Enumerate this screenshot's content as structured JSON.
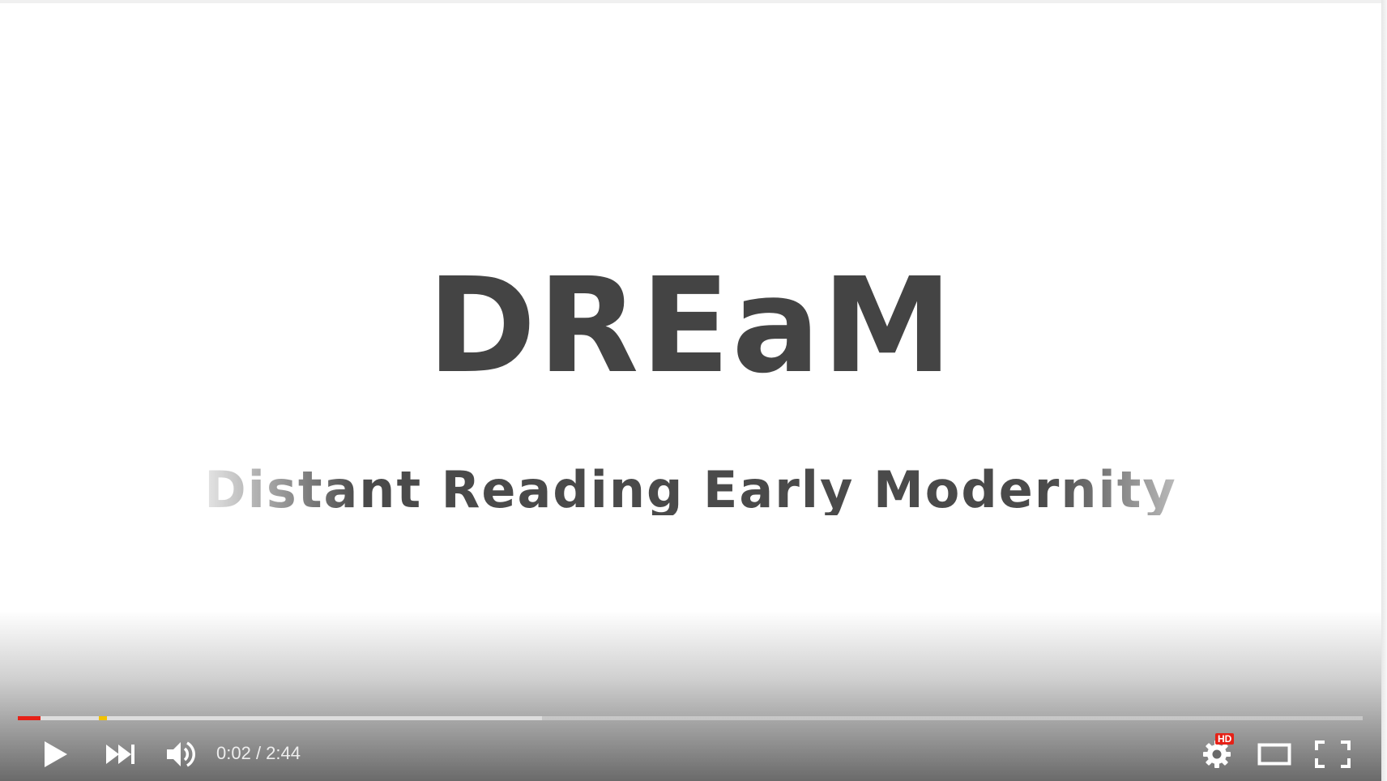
{
  "video": {
    "title": "DREaM",
    "subtitle": "Distant Reading Early Modernity"
  },
  "player": {
    "current_time": "0:02",
    "separator": " / ",
    "duration": "2:44",
    "played_fraction": 0.012,
    "buffered_fraction": 0.39,
    "hd_label": "HD",
    "played_color": "#e62117",
    "marker_color": "#f2c200"
  },
  "icons": {
    "play": "play-icon",
    "next": "next-icon",
    "volume": "volume-icon",
    "settings": "gear-icon",
    "theater": "theater-mode-icon",
    "fullscreen": "fullscreen-icon"
  }
}
